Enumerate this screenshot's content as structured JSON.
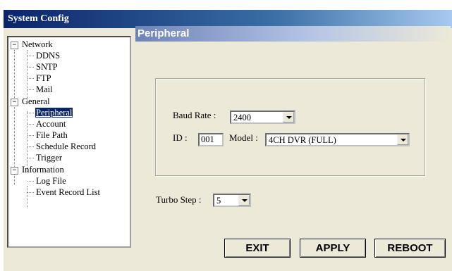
{
  "window": {
    "title": "System Config"
  },
  "tree": {
    "items": [
      {
        "label": "Network",
        "expander": "−"
      },
      {
        "label": "DDNS"
      },
      {
        "label": "SNTP"
      },
      {
        "label": "FTP"
      },
      {
        "label": "Mail"
      },
      {
        "label": "General",
        "expander": "−"
      },
      {
        "label": "Peripheral",
        "selected": true
      },
      {
        "label": "Account"
      },
      {
        "label": "File Path"
      },
      {
        "label": "Schedule Record"
      },
      {
        "label": "Trigger"
      },
      {
        "label": "Information",
        "expander": "−"
      },
      {
        "label": "Log File"
      },
      {
        "label": "Event Record List"
      }
    ]
  },
  "panel": {
    "title": "Peripheral",
    "baud_rate_label": "Baud Rate :",
    "baud_rate_value": "2400",
    "id_label": "ID :",
    "id_value": "001",
    "model_label": "Model :",
    "model_value": "4CH DVR (FULL)",
    "turbo_step_label": "Turbo Step :",
    "turbo_step_value": "5"
  },
  "buttons": {
    "exit": "EXIT",
    "apply": "APPLY",
    "reboot": "REBOOT"
  },
  "colors": {
    "title_bar": "#0a246a",
    "dialog_bg": "#ece9d8",
    "selection": "#0a246a"
  }
}
